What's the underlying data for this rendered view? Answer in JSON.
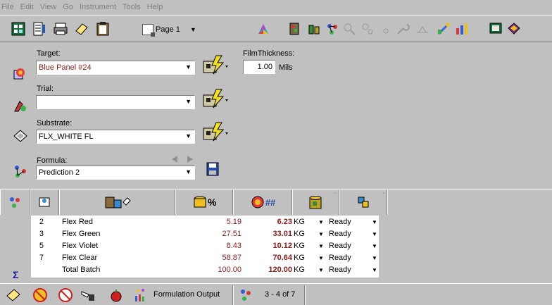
{
  "menu": {
    "items": [
      "File",
      "Edit",
      "View",
      "Go",
      "Instrument",
      "Tools",
      "Help"
    ]
  },
  "toolbar": {
    "page_label": "Page 1"
  },
  "target": {
    "label": "Target:",
    "value": "Blue Panel #24",
    "value_color": "#8b1a1a"
  },
  "film": {
    "label": "FilmThickness:",
    "value": "1.00",
    "unit": "Mils"
  },
  "trial": {
    "label": "Trial:",
    "value": ""
  },
  "substrate": {
    "label": "Substrate:",
    "value": "FLX_WHITE FL"
  },
  "formula": {
    "label": "Formula:",
    "value": "Prediction 2"
  },
  "grid": {
    "rows": [
      {
        "num": "2",
        "name": "Flex Red",
        "pct": "5.19",
        "amt": "6.23",
        "unit": "KG",
        "status": "Ready"
      },
      {
        "num": "3",
        "name": "Flex Green",
        "pct": "27.51",
        "amt": "33.01",
        "unit": "KG",
        "status": "Ready"
      },
      {
        "num": "5",
        "name": "Flex Violet",
        "pct": "8.43",
        "amt": "10.12",
        "unit": "KG",
        "status": "Ready"
      },
      {
        "num": "7",
        "name": "Flex Clear",
        "pct": "58.87",
        "amt": "70.64",
        "unit": "KG",
        "status": "Ready"
      },
      {
        "num": "",
        "name": "Total Batch",
        "pct": "100.00",
        "amt": "120.00",
        "unit": "KG",
        "status": "Ready"
      }
    ],
    "sigma": "Σ",
    "pct_header": "%",
    "amt_header": "##"
  },
  "status": {
    "output_label": "Formulation Output",
    "range": "3 - 4 of 7"
  },
  "colors": {
    "accent_red": "#8b1a1a",
    "sigma_blue": "#1a1aa0"
  }
}
